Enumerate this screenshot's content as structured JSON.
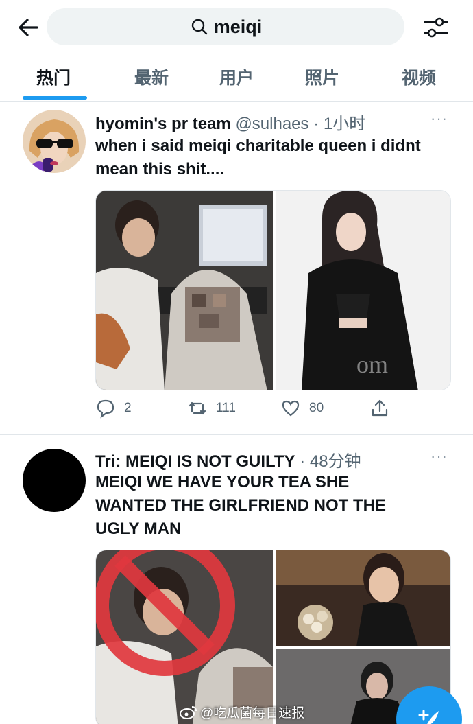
{
  "search": {
    "query": "meiqi"
  },
  "tabs": [
    {
      "label": "热门"
    },
    {
      "label": "最新"
    },
    {
      "label": "用户"
    },
    {
      "label": "照片"
    },
    {
      "label": "视频"
    }
  ],
  "tweets": [
    {
      "name": "hyomin's pr team",
      "handle": "@sulhaes",
      "time": "· 1小时",
      "text_part1": "when i said ",
      "text_bold": "meiqi",
      "text_part2": " charitable queen i didnt mean this shit....",
      "replies": "2",
      "retweets": "111",
      "likes": "80",
      "more": "···"
    },
    {
      "name": "Tri: MEIQI IS NOT GUILTY",
      "handle": "",
      "time": "· 48分钟",
      "text": "MEIQI WE HAVE YOUR TEA SHE WANTED THE GIRLFRIEND NOT THE UGLY MAN",
      "more": "···"
    }
  ],
  "watermark": "@吃瓜菌每日速报",
  "colors": {
    "accent": "#1d9bf0",
    "muted": "#536471"
  }
}
